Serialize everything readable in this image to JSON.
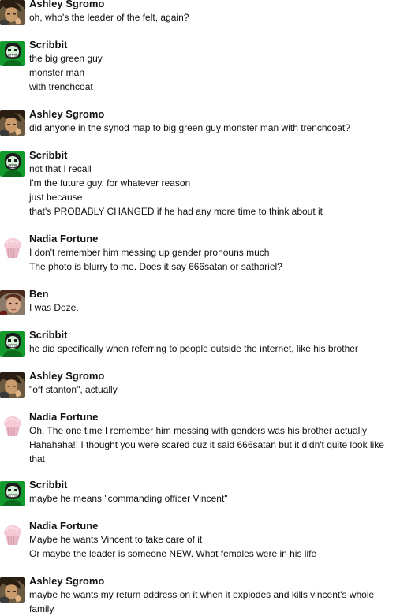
{
  "messages": [
    {
      "author": "Ashley Sgromo",
      "avatar_icon": "ashley-avatar-icon",
      "lines": [
        "oh, who's the leader of the felt, again?"
      ]
    },
    {
      "author": "Scribbit",
      "avatar_icon": "scribbit-avatar-icon",
      "lines": [
        "the big green guy",
        "monster man",
        "with trenchcoat"
      ]
    },
    {
      "author": "Ashley Sgromo",
      "avatar_icon": "ashley-avatar-icon",
      "lines": [
        "did anyone in the synod map to big green guy monster man with trenchcoat?"
      ]
    },
    {
      "author": "Scribbit",
      "avatar_icon": "scribbit-avatar-icon",
      "lines": [
        "not that I recall",
        "I'm the future guy, for whatever reason",
        "just because",
        "that's PROBABLY CHANGED if he had any more time to think about it"
      ]
    },
    {
      "author": "Nadia Fortune",
      "avatar_icon": "cupcake-avatar-icon",
      "lines": [
        "I don't remember him messing up gender pronouns much",
        "The photo is blurry to me. Does it say 666satan or sathariel?"
      ]
    },
    {
      "author": "Ben",
      "avatar_icon": "ben-avatar-icon",
      "lines": [
        "I was Doze."
      ]
    },
    {
      "author": "Scribbit",
      "avatar_icon": "scribbit-avatar-icon",
      "lines": [
        "he did specifically when referring to people outside the internet, like his brother"
      ]
    },
    {
      "author": "Ashley Sgromo",
      "avatar_icon": "ashley-avatar-icon",
      "lines": [
        "\"off stanton\", actually"
      ]
    },
    {
      "author": "Nadia Fortune",
      "avatar_icon": "cupcake-avatar-icon",
      "lines": [
        "Oh. The one time I remember him messing with genders was his brother actually",
        "Hahahaha!! I thought you were scared cuz it said 666satan but it didn't quite look like",
        "that"
      ]
    },
    {
      "author": "Scribbit",
      "avatar_icon": "scribbit-avatar-icon",
      "lines": [
        "maybe he means \"commanding officer Vincent\""
      ]
    },
    {
      "author": "Nadia Fortune",
      "avatar_icon": "cupcake-avatar-icon",
      "lines": [
        "Maybe he wants Vincent to take care of it",
        "Or maybe the leader is someone NEW. What females were in his life"
      ]
    },
    {
      "author": "Ashley Sgromo",
      "avatar_icon": "ashley-avatar-icon",
      "lines": [
        "maybe he wants my return address on it when it explodes and kills vincent's whole",
        "family"
      ]
    }
  ]
}
